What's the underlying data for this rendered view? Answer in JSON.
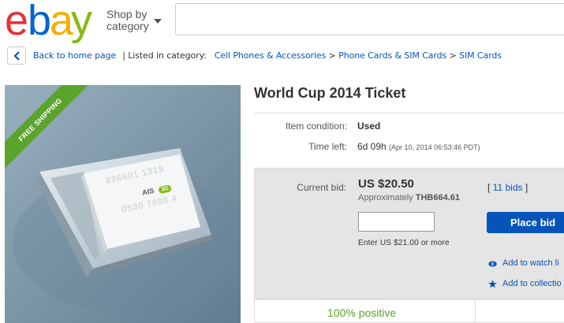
{
  "header": {
    "logo_letters": [
      "e",
      "b",
      "a",
      "y"
    ],
    "logo_colors": [
      "#e53238",
      "#0064d2",
      "#f5af02",
      "#86b817"
    ],
    "shop_by_line1": "Shop by",
    "shop_by_line2": "category",
    "search_placeholder": ""
  },
  "breadcrumb": {
    "back_label": "Back to home page",
    "listed_label": "| Listed in category:",
    "categories": [
      "Cell Phones & Accessories",
      "Phone Cards & SIM Cards",
      "SIM Cards"
    ],
    "separator": ">"
  },
  "product": {
    "ribbon": "FREE SHIPPING",
    "card_line1": "896601 1319",
    "card_logo": "AIS",
    "card_logo_badge": "3G",
    "card_line2": "0530 7898 4",
    "title": "World Cup 2014 Ticket"
  },
  "details": {
    "condition_label": "Item condition:",
    "condition_value": "Used",
    "time_left_label": "Time left:",
    "time_left_value": "6d 09h",
    "time_left_detail": "(Apr 10, 2014   06:53:46 PDT)"
  },
  "bidding": {
    "current_bid_label": "Current bid:",
    "price": "US $20.50",
    "approx_prefix": "Approximately",
    "approx_value": "THB664.61",
    "bids_open": "[",
    "bids_link": "11 bids",
    "bids_close": "]",
    "input_value": "",
    "enter_hint": "Enter US $21.00 or more",
    "place_bid_label": "Place bid",
    "watch_label": "Add to watch li",
    "collection_label": "Add to collectio"
  },
  "seller": {
    "positive": "100% positive"
  },
  "colors": {
    "link": "#0654ba",
    "button": "#0654ba",
    "ribbon": "#5ba32b",
    "positive": "#5ba32b"
  }
}
